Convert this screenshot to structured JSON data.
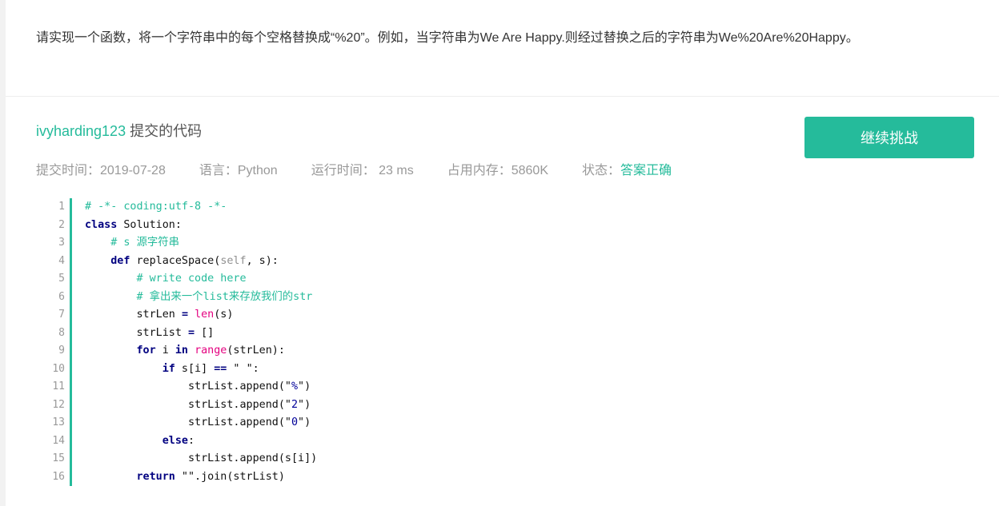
{
  "question": {
    "text": "请实现一个函数，将一个字符串中的每个空格替换成“%20”。例如，当字符串为We Are Happy.则经过替换之后的字符串为We%20Are%20Happy。"
  },
  "submission": {
    "username": "ivyharding123",
    "title_suffix": " 提交的代码",
    "continue_label": "继续挑战",
    "meta": {
      "submit_time": "提交时间：2019-07-28",
      "language": "语言：Python",
      "runtime": "运行时间： 23 ms",
      "memory": "占用内存：5860K",
      "status_label": "状态：",
      "status_value": "答案正确"
    }
  },
  "code": {
    "line_numbers": [
      "1",
      "2",
      "3",
      "4",
      "5",
      "6",
      "7",
      "8",
      "9",
      "10",
      "11",
      "12",
      "13",
      "14",
      "15",
      "16"
    ],
    "lines": [
      "# -*- coding:utf-8 -*-",
      "class Solution:",
      "    # s 源字符串",
      "    def replaceSpace(self, s):",
      "        # write code here",
      "        # 拿出来一个list来存放我们的str",
      "        strLen = len(s)",
      "        strList = []",
      "        for i in range(strLen):",
      "            if s[i] == \" \":",
      "                strList.append(\"%\")",
      "                strList.append(\"2\")",
      "                strList.append(\"0\")",
      "            else:",
      "                strList.append(s[i])",
      "        return \"\".join(strList)"
    ]
  },
  "colors": {
    "accent": "#25bb9b",
    "keyword": "#000080",
    "builtin": "#e4007f",
    "string": "#000099",
    "muted": "#999999"
  }
}
